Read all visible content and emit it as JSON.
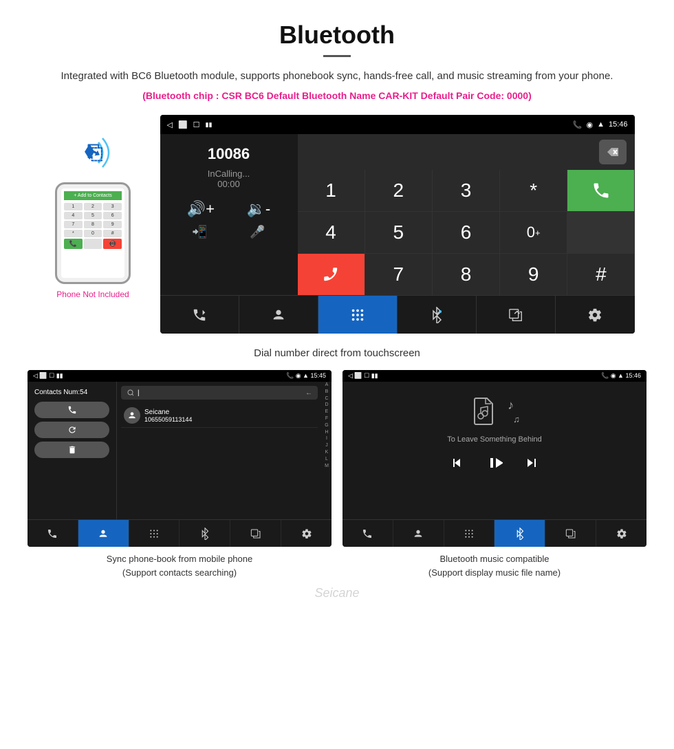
{
  "header": {
    "title": "Bluetooth",
    "description": "Integrated with BC6 Bluetooth module, supports phonebook sync, hands-free call, and music streaming from your phone.",
    "specs": "(Bluetooth chip : CSR BC6    Default Bluetooth Name CAR-KIT    Default Pair Code: 0000)"
  },
  "phone_side": {
    "not_included_label": "Phone Not Included"
  },
  "main_screen": {
    "status_bar": {
      "left_icons": [
        "back-icon",
        "home-icon",
        "recents-icon",
        "notification-icon"
      ],
      "right_icons": [
        "phone-icon",
        "location-icon",
        "wifi-icon"
      ],
      "time": "15:46"
    },
    "dial_number": "10086",
    "call_status": "InCalling...",
    "call_timer": "00:00",
    "numpad": [
      "1",
      "2",
      "3",
      "*",
      "4",
      "5",
      "6",
      "0+",
      "7",
      "8",
      "9",
      "#"
    ],
    "green_btn_icon": "phone-icon",
    "red_btn_icon": "phone-end-icon",
    "bottom_nav": [
      {
        "icon": "transfer-icon",
        "label": "transfer"
      },
      {
        "icon": "contact-icon",
        "label": "contact"
      },
      {
        "icon": "dialpad-icon",
        "label": "dialpad",
        "active": true
      },
      {
        "icon": "bluetooth-icon",
        "label": "bluetooth"
      },
      {
        "icon": "transfer2-icon",
        "label": "transfer2"
      },
      {
        "icon": "settings-icon",
        "label": "settings"
      }
    ]
  },
  "caption_main": "Dial number direct from touchscreen",
  "contacts_screen": {
    "status_bar_time": "15:45",
    "contacts_count": "Contacts Num:54",
    "action_btns": [
      "phone-icon",
      "refresh-icon",
      "delete-icon"
    ],
    "search_placeholder": "Search...",
    "contact": {
      "name": "Seicane",
      "number": "10655059113144"
    },
    "alpha_list": [
      "A",
      "B",
      "C",
      "D",
      "E",
      "F",
      "G",
      "H",
      "I",
      "J",
      "K",
      "L",
      "M"
    ],
    "bottom_nav": [
      {
        "icon": "phone-transfer-icon",
        "active": false
      },
      {
        "icon": "contact-icon",
        "active": true
      },
      {
        "icon": "dialpad-icon",
        "active": false
      },
      {
        "icon": "bluetooth-icon",
        "active": false
      },
      {
        "icon": "transfer-icon",
        "active": false
      },
      {
        "icon": "settings-icon",
        "active": false
      }
    ]
  },
  "music_screen": {
    "status_bar_time": "15:46",
    "song_title": "To Leave Something Behind",
    "controls": [
      "prev-icon",
      "play-pause-icon",
      "next-icon"
    ],
    "bottom_nav": [
      {
        "icon": "phone-transfer-icon",
        "active": false
      },
      {
        "icon": "contact-icon",
        "active": false
      },
      {
        "icon": "dialpad-icon",
        "active": false
      },
      {
        "icon": "bluetooth-icon",
        "active": true
      },
      {
        "icon": "transfer-icon",
        "active": false
      },
      {
        "icon": "settings-icon",
        "active": false
      }
    ]
  },
  "caption_contacts": {
    "line1": "Sync phone-book from mobile phone",
    "line2": "(Support contacts searching)"
  },
  "caption_music": {
    "line1": "Bluetooth music compatible",
    "line2": "(Support display music file name)"
  },
  "watermark": "Seicane"
}
